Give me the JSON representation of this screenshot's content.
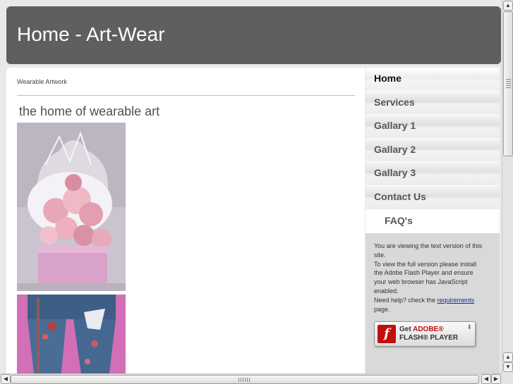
{
  "header": {
    "title": "Home - Art-Wear"
  },
  "main": {
    "breadcrumb": "Wearable Artwork",
    "subtitle": "the home of wearable art"
  },
  "nav": {
    "items": [
      {
        "label": "Home"
      },
      {
        "label": "Services"
      },
      {
        "label": "Gallary 1"
      },
      {
        "label": "Gallary 2"
      },
      {
        "label": "Gallary 3"
      },
      {
        "label": "Contact Us"
      },
      {
        "label": "FAQ's"
      }
    ]
  },
  "flash_notice": {
    "line1": "You are viewing the text version of this site.",
    "line2": "To view the full version please install the Adobe Flash Player and ensure your web browser has JavaScript enabled.",
    "help_prefix": "Need help? check the",
    "help_link": "requirements",
    "help_suffix": "page.",
    "button_get": "Get",
    "button_brand": "ADOBE®",
    "button_product": "FLASH® PLAYER",
    "logo_glyph": "f"
  },
  "colors": {
    "header_bg": "#5f5f5f",
    "sidebar_bg": "#d9d9d9",
    "flash_red": "#c10e0e"
  },
  "icons": {
    "scroll_up": "▲",
    "scroll_down": "▼",
    "scroll_left": "◀",
    "scroll_right": "▶",
    "download": "⬇"
  }
}
